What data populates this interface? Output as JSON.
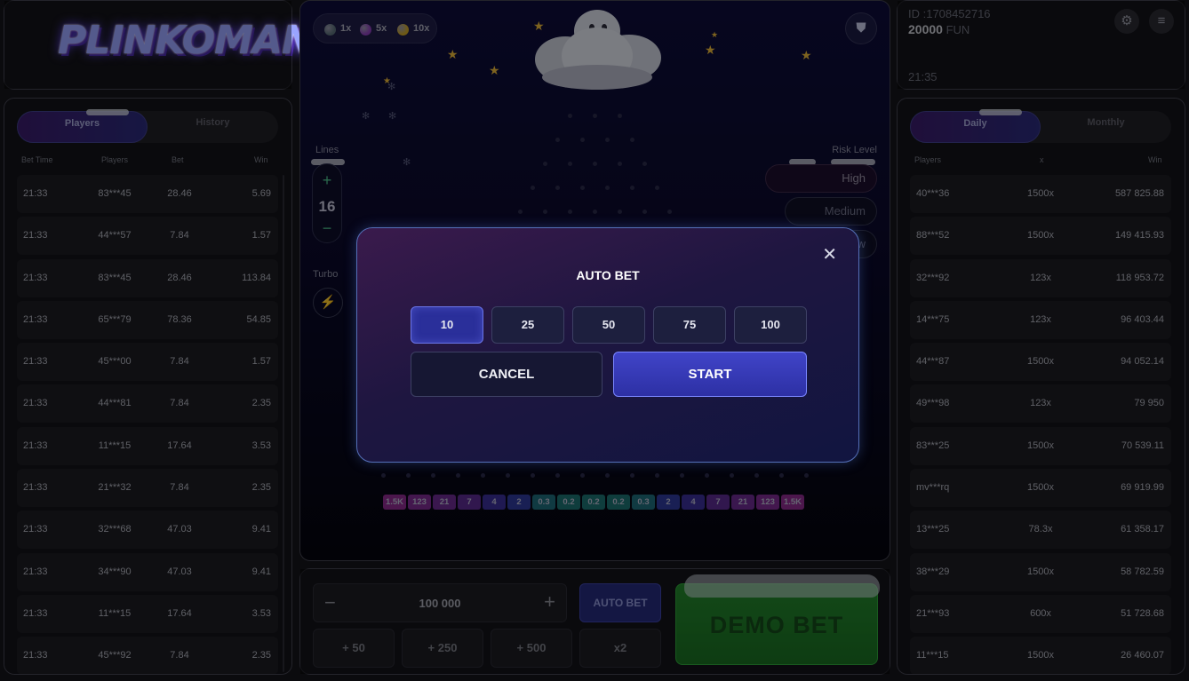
{
  "logo": {
    "text": "PLINKOMAN"
  },
  "left_panel": {
    "tabs": [
      "Players",
      "History"
    ],
    "columns": [
      "Bet Time",
      "Players",
      "Bet",
      "Win"
    ],
    "rows": [
      [
        "21:33",
        "83***45",
        "28.46",
        "5.69"
      ],
      [
        "21:33",
        "44***57",
        "7.84",
        "1.57"
      ],
      [
        "21:33",
        "83***45",
        "28.46",
        "113.84"
      ],
      [
        "21:33",
        "65***79",
        "78.36",
        "54.85"
      ],
      [
        "21:33",
        "45***00",
        "7.84",
        "1.57"
      ],
      [
        "21:33",
        "44***81",
        "7.84",
        "2.35"
      ],
      [
        "21:33",
        "11***15",
        "17.64",
        "3.53"
      ],
      [
        "21:33",
        "21***32",
        "7.84",
        "2.35"
      ],
      [
        "21:33",
        "32***68",
        "47.03",
        "9.41"
      ],
      [
        "21:33",
        "34***90",
        "47.03",
        "9.41"
      ],
      [
        "21:33",
        "11***15",
        "17.64",
        "3.53"
      ],
      [
        "21:33",
        "45***92",
        "7.84",
        "2.35"
      ]
    ]
  },
  "top_right": {
    "id": "ID :1708452716",
    "balance": "20000",
    "currency": "FUN",
    "time": "21:35",
    "settings_icon": "gear-icon",
    "menu_icon": "menu-icon"
  },
  "right_panel": {
    "tabs": [
      "Daily",
      "Monthly"
    ],
    "columns": [
      "Players",
      "x",
      "Win"
    ],
    "rows": [
      [
        "40***36",
        "1500x",
        "587 825.88"
      ],
      [
        "88***52",
        "1500x",
        "149 415.93"
      ],
      [
        "32***92",
        "123x",
        "118 953.72"
      ],
      [
        "14***75",
        "123x",
        "96 403.44"
      ],
      [
        "44***87",
        "1500x",
        "94 052.14"
      ],
      [
        "49***98",
        "123x",
        "79 950"
      ],
      [
        "83***25",
        "1500x",
        "70 539.11"
      ],
      [
        "mv***rq",
        "1500x",
        "69 919.99"
      ],
      [
        "13***25",
        "78.3x",
        "61 358.17"
      ],
      [
        "38***29",
        "1500x",
        "58 782.59"
      ],
      [
        "21***93",
        "600x",
        "51 728.68"
      ],
      [
        "11***15",
        "1500x",
        "26 460.07"
      ]
    ]
  },
  "game": {
    "ball_legend": [
      {
        "label": "1x",
        "color": "#5a6e78"
      },
      {
        "label": "5x",
        "color": "#8a3fb8"
      },
      {
        "label": "10x",
        "color": "#c9a227"
      }
    ],
    "lines_label": "Lines",
    "lines_value": "16",
    "turbo_label": "Turbo",
    "risk_label": "Risk Level",
    "risk_levels": [
      "High",
      "Medium",
      "Low"
    ],
    "selected_risk": "High",
    "multipliers": [
      "1.5K",
      "123",
      "21",
      "7",
      "4",
      "2",
      "0.3",
      "0.2",
      "0.2",
      "0.2",
      "0.3",
      "2",
      "4",
      "7",
      "21",
      "123",
      "1.5K"
    ],
    "multiplier_colors": [
      "#8a2a8c",
      "#7a2a8e",
      "#6a2a8e",
      "#5a2a8e",
      "#3a2e96",
      "#2e3a9a",
      "#1e6a78",
      "#1c7070",
      "#1c7070",
      "#1c7070",
      "#1e6a78",
      "#2e3a9a",
      "#3a2e96",
      "#5a2a8e",
      "#6a2a8e",
      "#7a2a8e",
      "#8a2a8c"
    ]
  },
  "modal": {
    "title": "AUTO BET",
    "options": [
      "10",
      "25",
      "50",
      "75",
      "100"
    ],
    "selected": "10",
    "cancel_label": "CANCEL",
    "start_label": "START"
  },
  "controls": {
    "amount": "100 000",
    "auto_bet_label": "AUTO BET",
    "quick_bets": [
      "+ 50",
      "+ 250",
      "+ 500",
      "x2"
    ],
    "demo_bet_label": "DEMO BET"
  }
}
